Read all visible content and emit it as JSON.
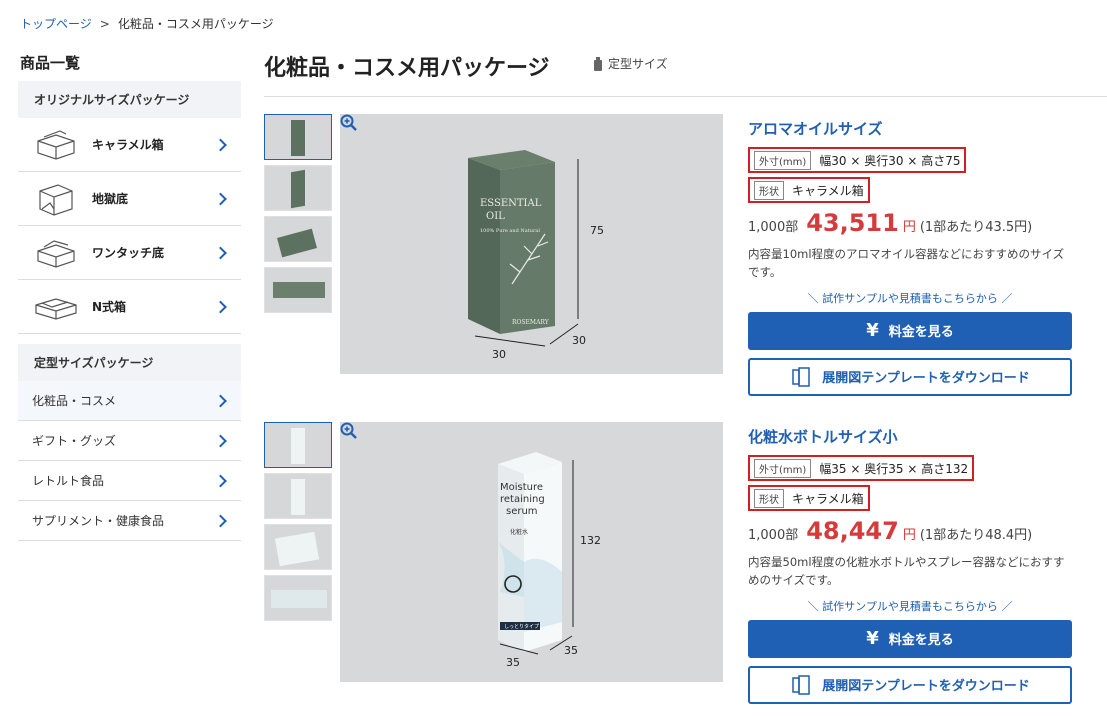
{
  "breadcrumb": {
    "home": "トップページ",
    "current": "化粧品・コスメ用パッケージ"
  },
  "sidebar": {
    "title": "商品一覧",
    "section1": "オリジナルサイズパッケージ",
    "items": [
      {
        "label": "キャラメル箱",
        "icon": "caramel-box-icon"
      },
      {
        "label": "地獄底",
        "icon": "jigoku-bottom-box-icon"
      },
      {
        "label": "ワンタッチ底",
        "icon": "one-touch-box-icon"
      },
      {
        "label": "N式箱",
        "icon": "n-type-box-icon"
      }
    ],
    "section2": "定型サイズパッケージ",
    "links": [
      {
        "label": "化粧品・コスメ"
      },
      {
        "label": "ギフト・グッズ"
      },
      {
        "label": "レトルト食品"
      },
      {
        "label": "サプリメント・健康食品"
      }
    ]
  },
  "header": {
    "title": "化粧品・コスメ用パッケージ",
    "tag": "定型サイズ"
  },
  "products": [
    {
      "name": "アロマオイルサイズ",
      "dim_label": "外寸(mm)",
      "dims": "幅30 × 奥行30 × 高さ75",
      "shape_label": "形状",
      "shape": "キャラメル箱",
      "qty": "1,000部",
      "price": "43,511",
      "unit": "円",
      "per": "(1部あたり43.5円)",
      "desc": "内容量10ml程度のアロマオイル容器などにおすすめのサイズです。",
      "sample": "＼ 試作サンプルや見積書もこちらから ／",
      "price_button": "料金を見る",
      "download_button": "展開図テンプレートをダウンロード",
      "box_text": [
        "ESSENTIAL",
        "OIL",
        "100% Pure and Natural",
        "ROSEMARY"
      ],
      "dim_w": "30",
      "dim_d": "30",
      "dim_h": "75"
    },
    {
      "name": "化粧水ボトルサイズ小",
      "dim_label": "外寸(mm)",
      "dims": "幅35 × 奥行35 × 高さ132",
      "shape_label": "形状",
      "shape": "キャラメル箱",
      "qty": "1,000部",
      "price": "48,447",
      "unit": "円",
      "per": "(1部あたり48.4円)",
      "desc": "内容量50ml程度の化粧水ボトルやスプレー容器などにおすすめのサイズです。",
      "sample": "＼ 試作サンプルや見積書もこちらから ／",
      "price_button": "料金を見る",
      "download_button": "展開図テンプレートをダウンロード",
      "box_text": [
        "Moisture",
        "retaining",
        "serum",
        "化粧水",
        "しっとりタイプ"
      ],
      "dim_w": "35",
      "dim_d": "35",
      "dim_h": "132"
    }
  ]
}
